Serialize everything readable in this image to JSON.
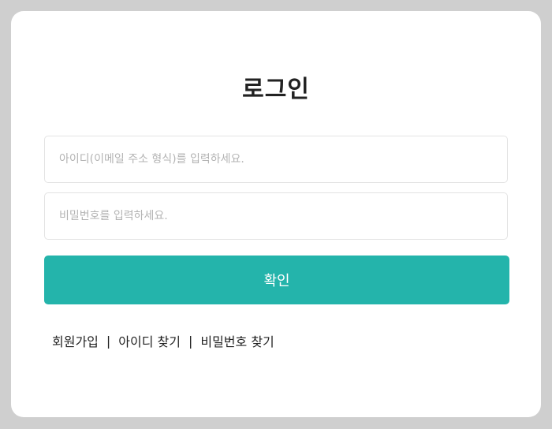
{
  "login": {
    "title": "로그인",
    "id_placeholder": "아이디(이메일 주소 형식)를 입력하세요.",
    "id_value": "",
    "password_placeholder": "비밀번호를 입력하세요.",
    "password_value": "",
    "submit_label": "확인",
    "links": {
      "signup": "회원가입",
      "find_id": "아이디 찾기",
      "find_password": "비밀번호 찾기",
      "separator": "|"
    }
  },
  "colors": {
    "accent": "#24b4ab",
    "background": "#cfcfcf",
    "card": "#ffffff"
  }
}
